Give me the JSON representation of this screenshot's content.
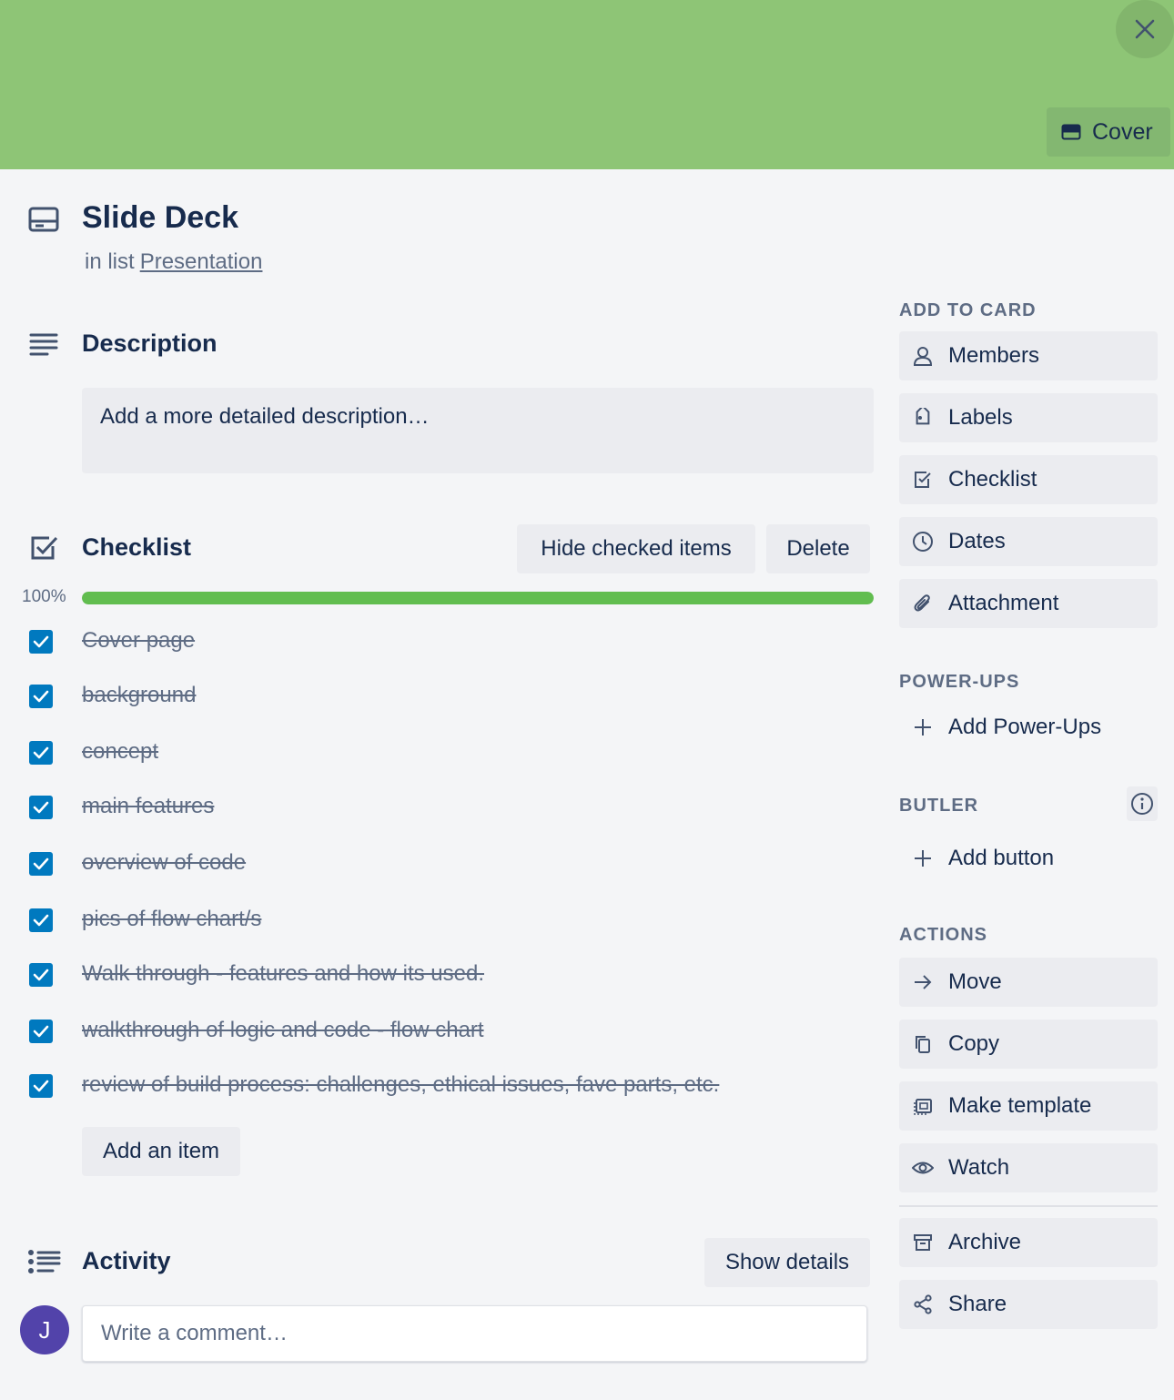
{
  "colors": {
    "cover": "#8ec576",
    "accent": "#0079bf",
    "progress": "#61bd4f"
  },
  "header": {
    "close_icon": "close-icon",
    "cover_button": "Cover"
  },
  "card": {
    "title": "Slide Deck",
    "in_list_prefix": "in list",
    "list_name": "Presentation"
  },
  "description": {
    "heading": "Description",
    "placeholder": "Add a more detailed description…"
  },
  "checklist": {
    "heading": "Checklist",
    "hide_button": "Hide checked items",
    "delete_button": "Delete",
    "progress_label": "100%",
    "progress": 1.0,
    "items": [
      {
        "text": "Cover page",
        "checked": true
      },
      {
        "text": "background",
        "checked": true
      },
      {
        "text": "concept",
        "checked": true
      },
      {
        "text": "main features",
        "checked": true
      },
      {
        "text": "overview of code",
        "checked": true
      },
      {
        "text": "pics of flow chart/s",
        "checked": true
      },
      {
        "text": "Walk through - features and how its used.",
        "checked": true
      },
      {
        "text": "walkthrough of logic and code - flow chart",
        "checked": true
      },
      {
        "text": "review of build process: challenges, ethical issues, fave parts, etc.",
        "checked": true
      }
    ],
    "add_item_button": "Add an item"
  },
  "activity": {
    "heading": "Activity",
    "show_details_button": "Show details",
    "avatar_initial": "J",
    "comment_placeholder": "Write a comment…"
  },
  "sidebar": {
    "add_to_card": {
      "heading": "ADD TO CARD",
      "items": [
        {
          "label": "Members",
          "icon": "person-icon"
        },
        {
          "label": "Labels",
          "icon": "tag-icon"
        },
        {
          "label": "Checklist",
          "icon": "checklist-icon"
        },
        {
          "label": "Dates",
          "icon": "clock-icon"
        },
        {
          "label": "Attachment",
          "icon": "paperclip-icon"
        }
      ]
    },
    "power_ups": {
      "heading": "POWER-UPS",
      "add_label": "Add Power-Ups"
    },
    "butler": {
      "heading": "BUTLER",
      "add_label": "Add button"
    },
    "actions": {
      "heading": "ACTIONS",
      "items": [
        {
          "label": "Move",
          "icon": "arrow-right-icon"
        },
        {
          "label": "Copy",
          "icon": "copy-icon"
        },
        {
          "label": "Make template",
          "icon": "template-icon"
        },
        {
          "label": "Watch",
          "icon": "eye-icon"
        },
        {
          "label": "Archive",
          "icon": "archive-icon"
        },
        {
          "label": "Share",
          "icon": "share-icon"
        }
      ]
    }
  }
}
